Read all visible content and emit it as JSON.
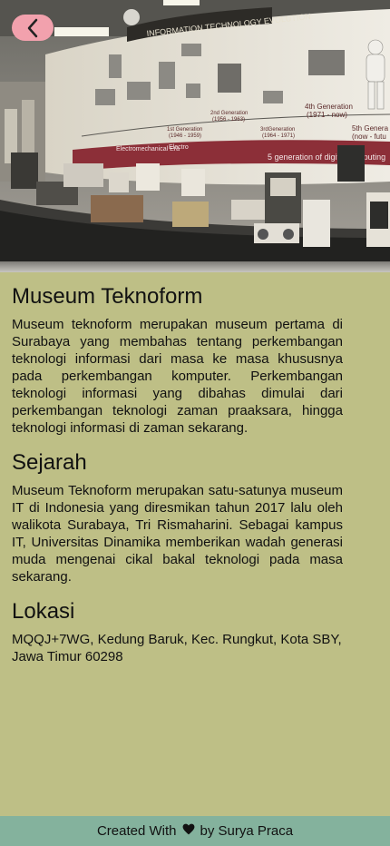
{
  "hero": {
    "banner_title": "INFORMATION TECHNOLOGY EVOLUTION",
    "banner_bottom": "5 generation of digital computing",
    "generations": [
      {
        "label": "1st Generation",
        "years": "(1946 - 1959)"
      },
      {
        "label": "2nd Generation",
        "years": "(1956 - 1963)"
      },
      {
        "label": "3rdGeneration",
        "years": "(1964 - 1971)"
      },
      {
        "label": "4th Generation",
        "years": "(1971 - now)"
      },
      {
        "label": "5th Genera",
        "years": "(now - futu"
      }
    ],
    "era_labels": [
      "Electromechanical Era",
      "Electro"
    ]
  },
  "back_button": {
    "icon": "chevron-left-icon"
  },
  "sections": [
    {
      "title": "Museum Teknoform",
      "body": "Museum teknoform merupakan museum pertama di Surabaya yang membahas tentang perkembangan teknologi informasi dari masa ke masa khususnya pada perkembangan komputer. Perkembangan teknologi informasi yang dibahas dimulai dari perkembangan teknologi zaman praaksara, hingga teknologi informasi di zaman sekarang."
    },
    {
      "title": "Sejarah",
      "body": "Museum Teknoform merupakan satu-satunya museum IT di Indonesia yang diresmikan tahun 2017 lalu oleh walikota Surabaya, Tri Rismaharini. Sebagai kampus IT, Universitas Dinamika memberikan wadah generasi muda mengenai cikal bakal teknologi pada masa sekarang."
    },
    {
      "title": "Lokasi",
      "body": "MQQJ+7WG, Kedung Baruk, Kec. Rungkut, Kota SBY, Jawa Timur 60298"
    }
  ],
  "footer": {
    "prefix": "Created With",
    "icon": "heart-icon",
    "suffix": "by Surya Praca"
  },
  "colors": {
    "background": "#bebf86",
    "footer": "#84b29d",
    "back_button": "#f2a1ad",
    "banner_red": "#8c2f38"
  }
}
